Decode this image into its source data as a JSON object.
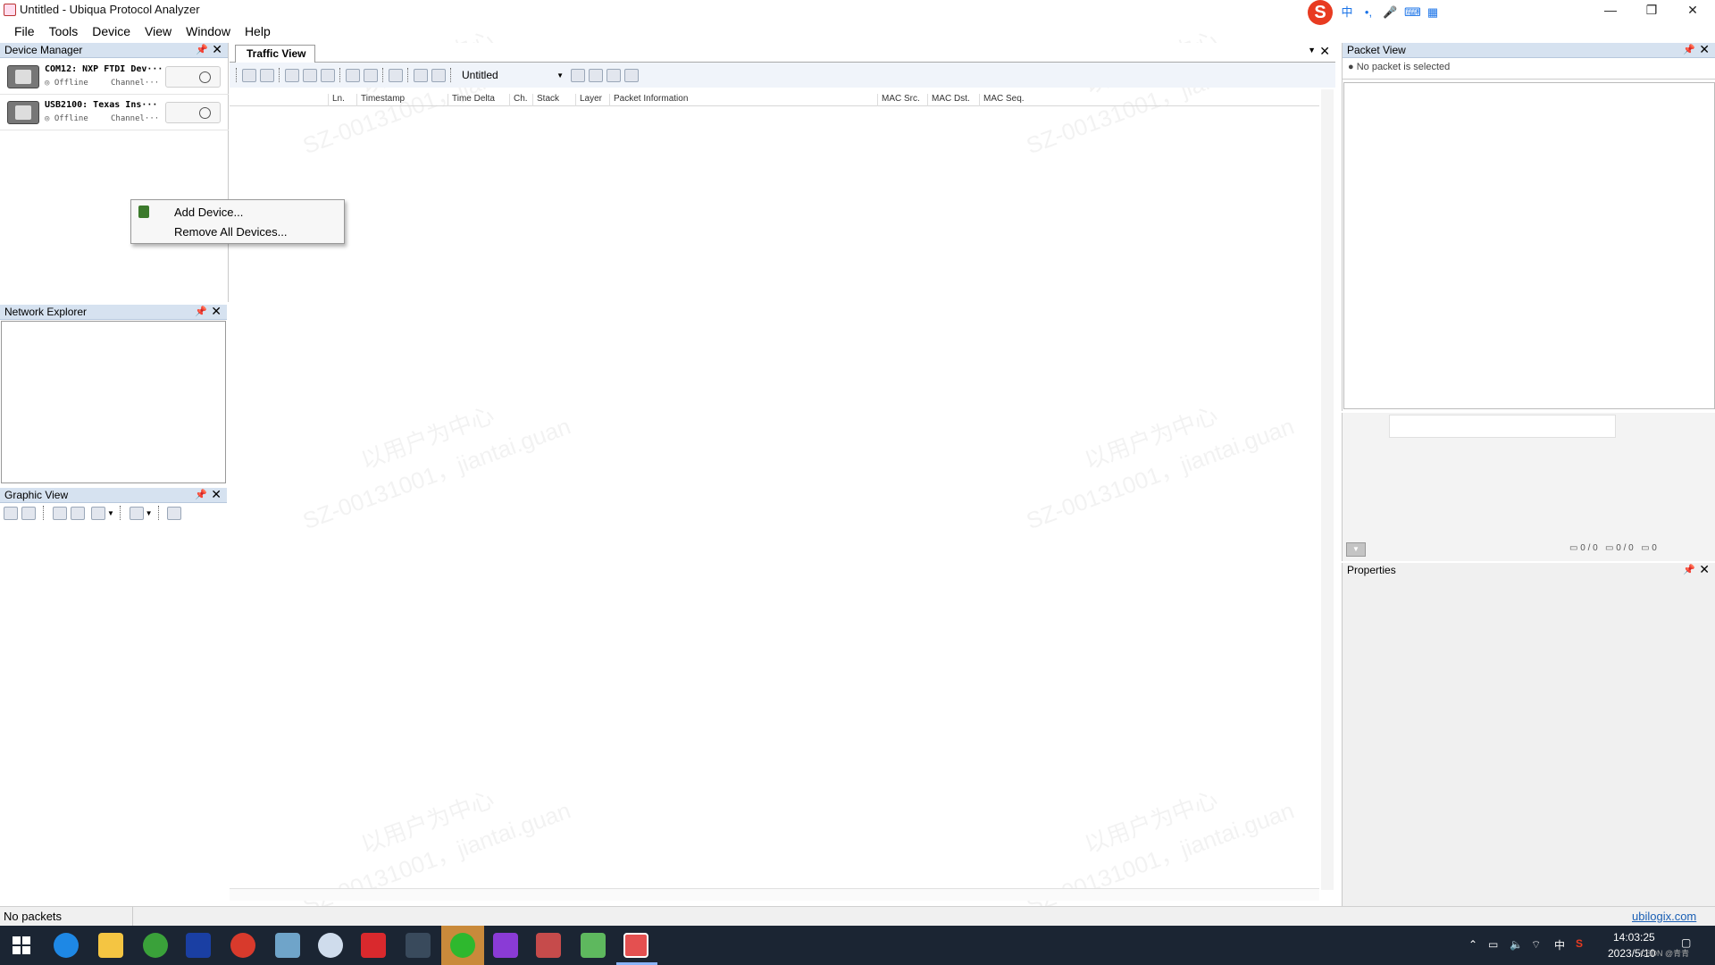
{
  "window": {
    "title": "Untitled - Ubiqua Protocol Analyzer",
    "minimize": "—",
    "restore": "❐",
    "close": "✕"
  },
  "ime": {
    "logo": "S",
    "mode": "中",
    "punct": "•,",
    "mic": "🎤",
    "keyboard": "⌨",
    "apps": "▦"
  },
  "menu": [
    "File",
    "Tools",
    "Device",
    "View",
    "Window",
    "Help"
  ],
  "device_manager": {
    "title": "Device Manager",
    "devices": [
      {
        "name": "COM12: NXP FTDI Dev···",
        "status": "Offline",
        "channel": "Channel···"
      },
      {
        "name": "USB2100: Texas Ins···",
        "status": "Offline",
        "channel": "Channel···"
      }
    ]
  },
  "context_menu": {
    "items": [
      "Add Device...",
      "Remove All Devices..."
    ]
  },
  "network_explorer": {
    "title": "Network Explorer"
  },
  "graphic_view": {
    "title": "Graphic View"
  },
  "traffic_view": {
    "tab": "Traffic View",
    "filter_combo": "Untitled",
    "columns": [
      "Ln.",
      "Timestamp",
      "Time Delta",
      "Ch.",
      "Stack",
      "Layer",
      "Packet Information",
      "MAC Src.",
      "MAC Dst.",
      "MAC Seq."
    ]
  },
  "packet_view": {
    "title": "Packet View",
    "empty_text": "No packet is selected",
    "counts": [
      "0 / 0",
      "0 / 0",
      "0"
    ]
  },
  "properties": {
    "title": "Properties"
  },
  "watermark": {
    "line1": "以用户为中心",
    "line2": "SZ-00131001，jiantai.guan"
  },
  "status": {
    "text": "No packets",
    "link": "ubilogix.com"
  },
  "taskbar": {
    "time": "14:03:25",
    "date": "2023/5/10",
    "tray_ime": "中",
    "corner": "CSDN @青青"
  },
  "colors": {
    "panel_header": "#d6e2f0",
    "taskbar": "#1b2533",
    "link": "#1a5fb4"
  }
}
